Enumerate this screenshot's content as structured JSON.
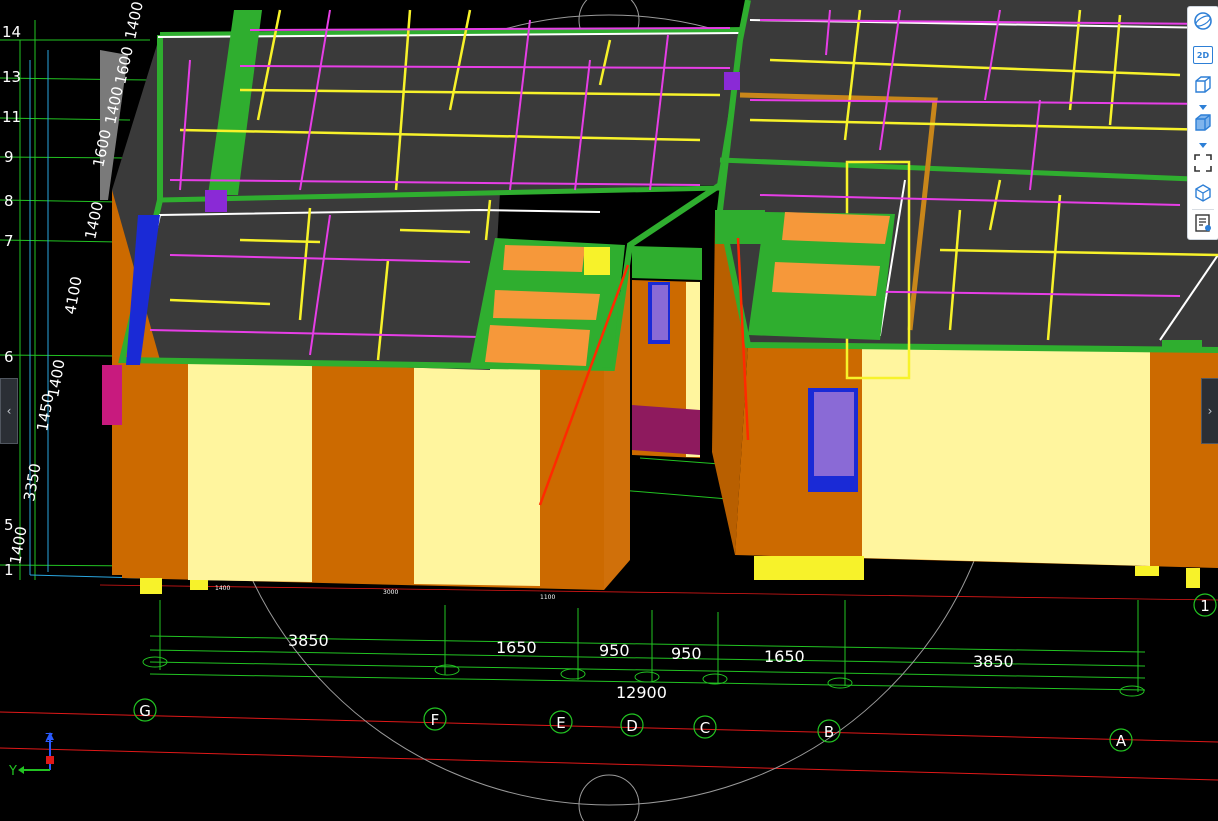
{
  "view": {
    "colors": {
      "background": "#000000",
      "wall_orange": "#cc6a00",
      "wall_cream": "#fff59e",
      "slab_grey": "#3a3a3a",
      "beam_green": "#2fae2f",
      "rebar_yellow": "#f7f22a",
      "rebar_magenta": "#e63ee6",
      "grid_green": "#22c322",
      "axis_red": "#e01818",
      "window_blue": "#1a2ad6",
      "window_violet": "#8a6ad6",
      "orbit_circle": "#9a9a9a"
    }
  },
  "axis_labels": {
    "row_numbers": [
      "14",
      "13",
      "11",
      "9",
      "8",
      "7",
      "6",
      "5",
      "1"
    ],
    "left_dimensions": [
      "1400",
      "1600",
      "1400",
      "1600",
      "1400",
      "4100",
      "1400",
      "1450",
      "3350",
      "1400"
    ],
    "bottom_dimensions": [
      "3850",
      "1650",
      "950",
      "950",
      "1650",
      "3850"
    ],
    "total_dimension": "12900",
    "grid_bubbles": [
      "G",
      "F",
      "E",
      "D",
      "C",
      "B",
      "A"
    ],
    "right_bubble": "1",
    "small_dims": [
      "1400",
      "3000",
      "1100"
    ]
  },
  "triad": {
    "z": "Z",
    "y": "Y"
  },
  "toolbar": {
    "items": [
      {
        "icon": "orbit-icon"
      },
      {
        "icon": "view-2d-icon",
        "text": "2D"
      },
      {
        "icon": "box-wire-icon"
      },
      {
        "icon": "box-solid-icon"
      },
      {
        "icon": "fit-view-icon"
      },
      {
        "icon": "cube-view-icon"
      },
      {
        "icon": "properties-icon"
      }
    ]
  },
  "side_handles": {
    "left": "‹",
    "right": "›"
  }
}
